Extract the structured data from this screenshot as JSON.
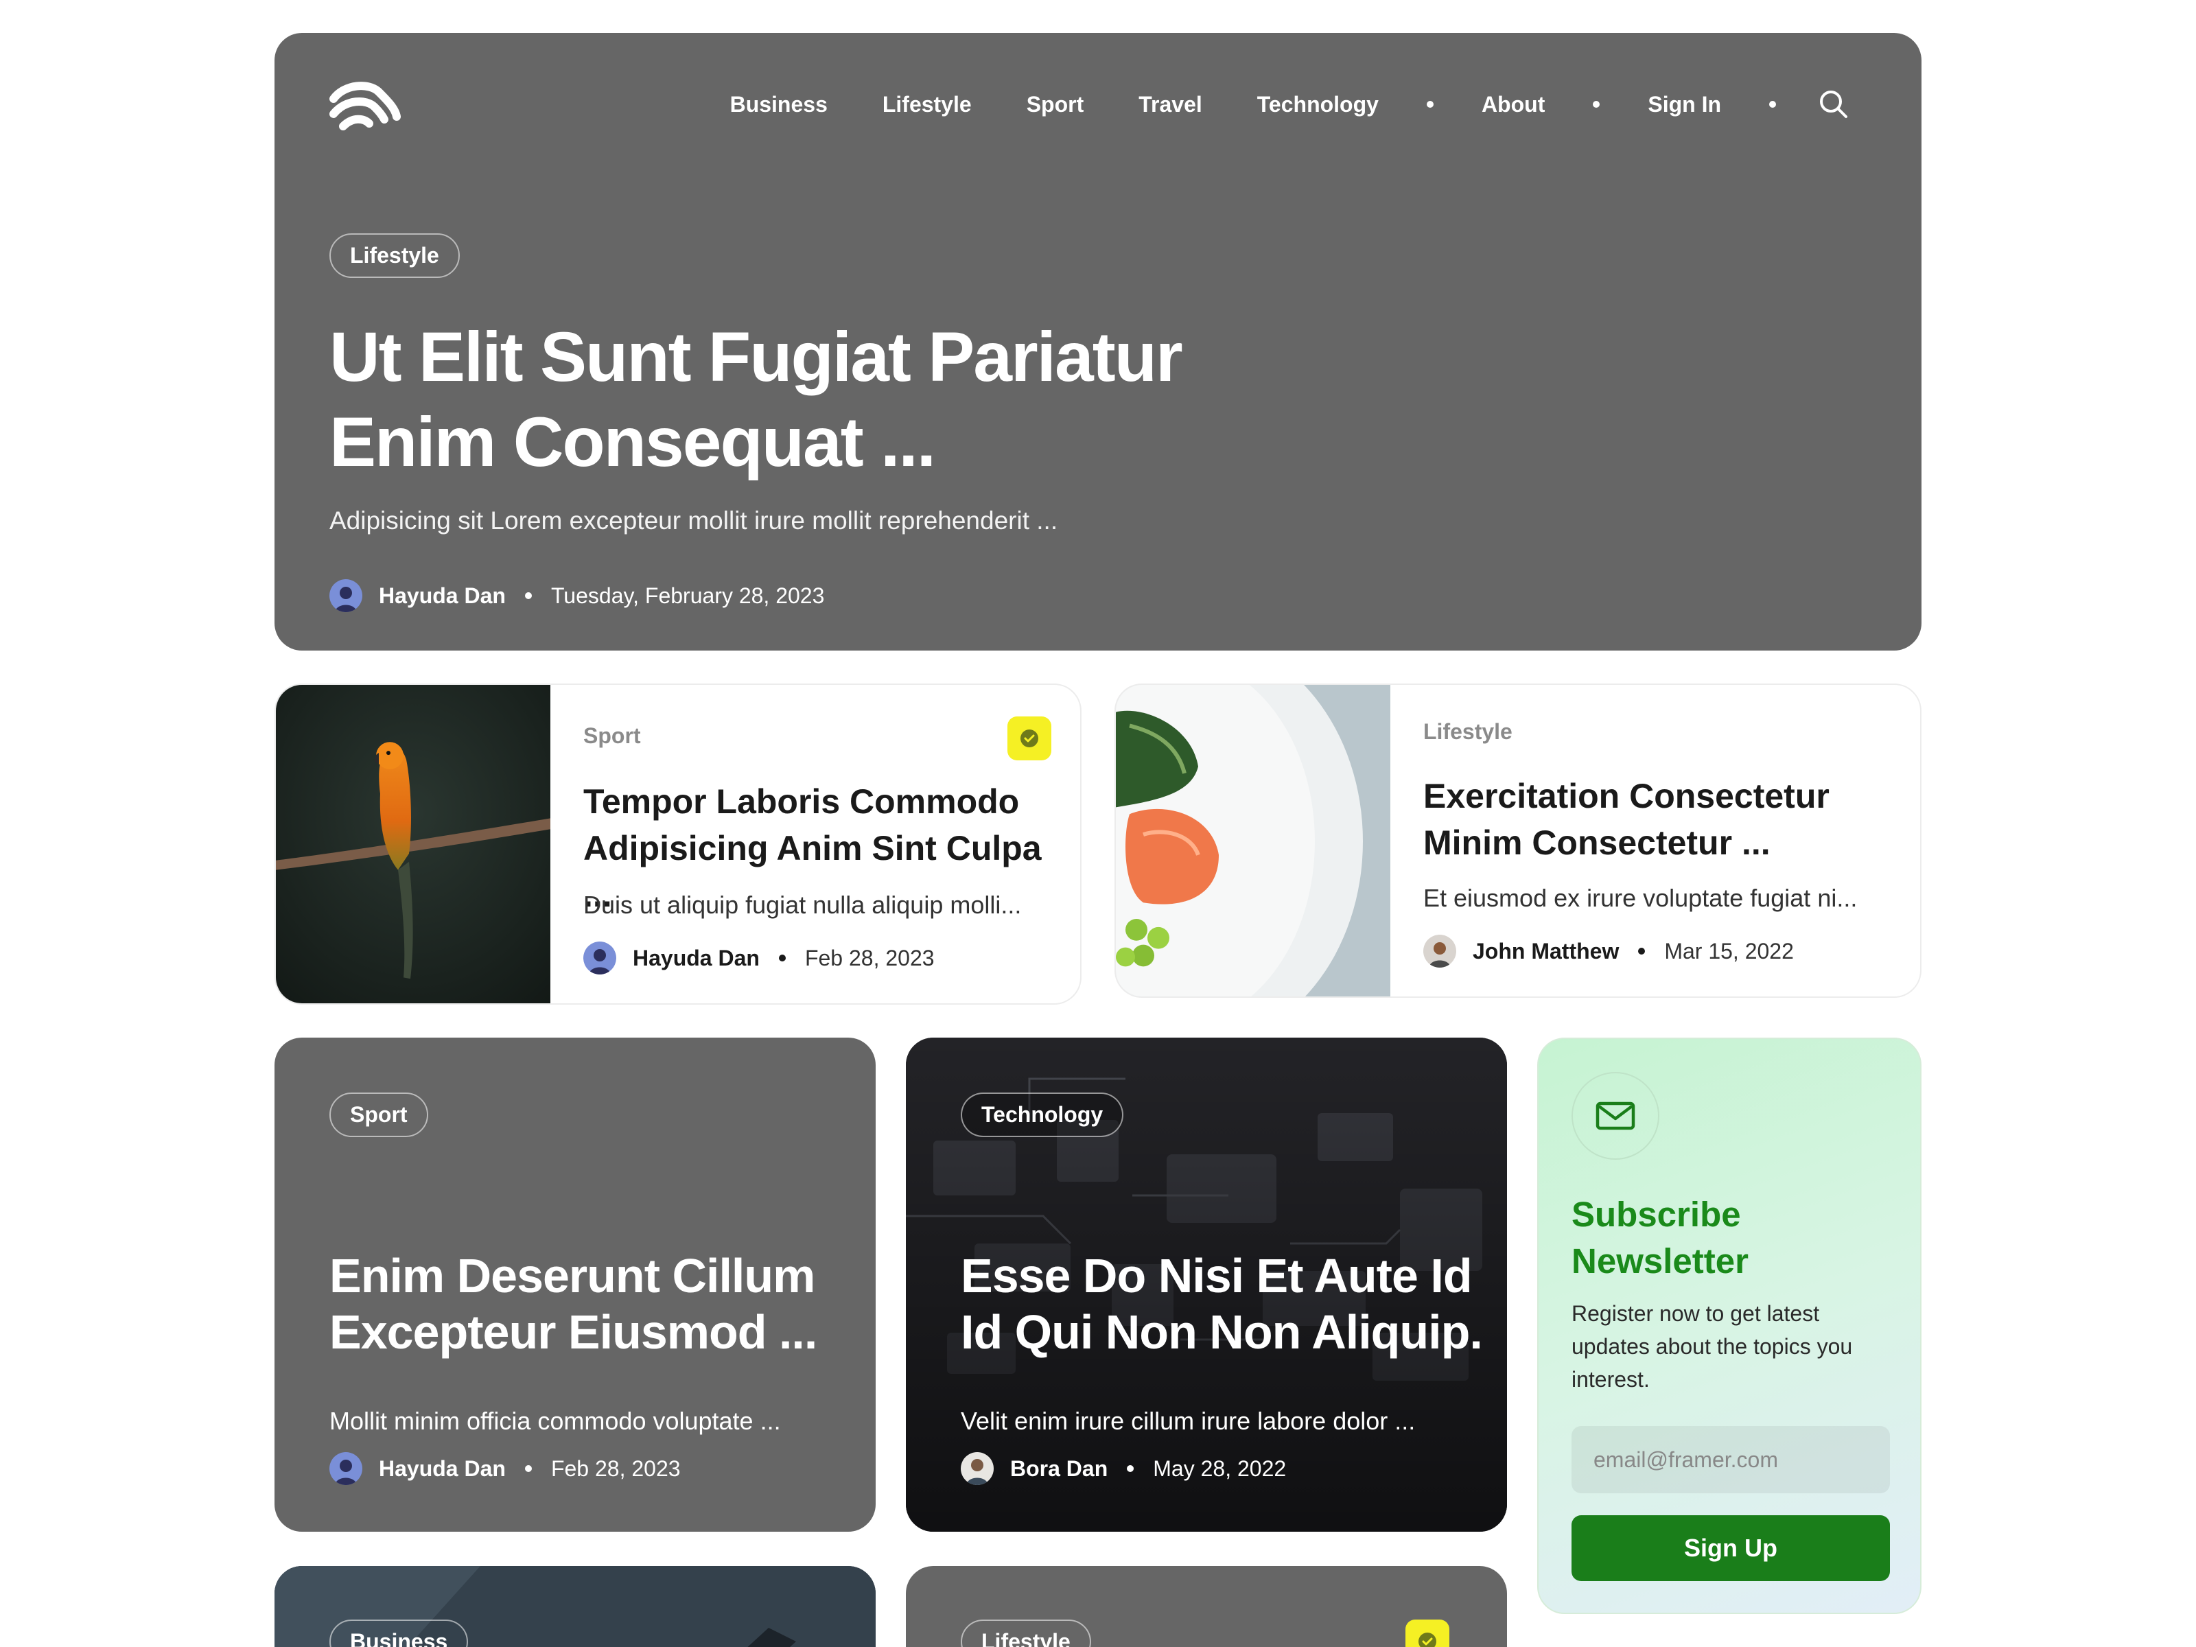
{
  "nav": {
    "items": [
      "Business",
      "Lifestyle",
      "Sport",
      "Travel",
      "Technology",
      "About",
      "Sign In"
    ],
    "search_icon": "search-icon"
  },
  "hero": {
    "category": "Lifestyle",
    "title": "Ut Elit Sunt Fugiat Pariatur Enim Consequat ...",
    "excerpt": "Adipisicing sit Lorem excepteur mollit irure mollit reprehenderit ...",
    "author": "Hayuda Dan",
    "date": "Tuesday, February 28, 2023"
  },
  "featured": [
    {
      "category": "Sport",
      "title": "Tempor Laboris Commodo Adipisicing Anim Sint Culpa ...",
      "excerpt": "Duis ut aliquip fugiat nulla aliquip molli...",
      "author": "Hayuda Dan",
      "date": "Feb 28, 2023",
      "image": "parrot-photo",
      "badge": "verified-badge-icon"
    },
    {
      "category": "Lifestyle",
      "title": "Exercitation Consectetur Minim Consectetur ...",
      "excerpt": "Et eiusmod ex irure voluptate fugiat ni...",
      "author": "John Matthew",
      "date": "Mar 15, 2022",
      "image": "salmon-bowl-photo"
    }
  ],
  "cards": [
    {
      "category": "Sport",
      "title": "Enim Deserunt Cillum Excepteur Eiusmod ...",
      "excerpt": "Mollit minim officia commodo voluptate ...",
      "author": "Hayuda Dan",
      "date": "Feb 28, 2023"
    },
    {
      "category": "Technology",
      "title": "Esse Do Nisi Et Aute Id Id Qui Non Non Aliquip.",
      "excerpt": "Velit enim irure cillum irure labore dolor ...",
      "author": "Bora Dan",
      "date": "May 28, 2022",
      "image": "circuit-board-photo"
    }
  ],
  "newsletter": {
    "icon": "mail-icon",
    "title": "Subscribe Newsletter",
    "description": "Register now to get latest updates about the topics you interest.",
    "placeholder": "email@framer.com",
    "button": "Sign Up"
  },
  "bottom_cards": [
    {
      "category": "Business"
    },
    {
      "category": "Lifestyle",
      "badge": "verified-badge-icon"
    }
  ],
  "colors": {
    "card_gray": "#666666",
    "accent_green": "#1a7e1a",
    "badge_yellow": "#f5f024"
  }
}
